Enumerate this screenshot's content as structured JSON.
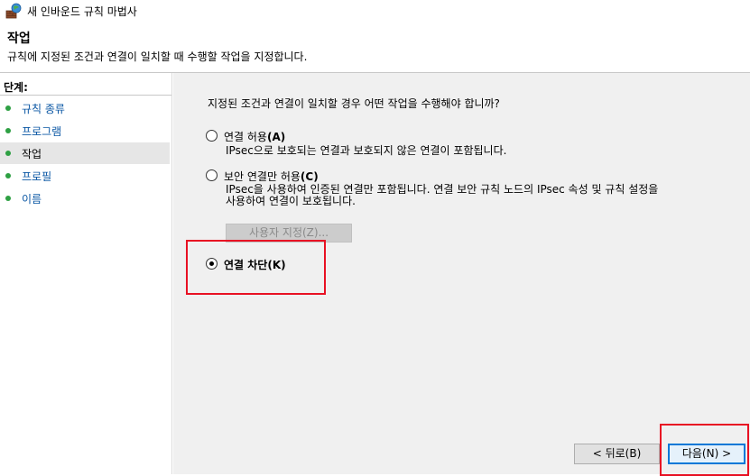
{
  "window": {
    "title": "새 인바운드 규칙 마법사",
    "icon": "firewall-wizard-icon"
  },
  "header": {
    "title": "작업",
    "description": "규칙에 지정된 조건과 연결이 일치할 때 수행할 작업을 지정합니다."
  },
  "steps": {
    "label": "단계:",
    "items": [
      {
        "label": "규칙 종류",
        "current": false
      },
      {
        "label": "프로그램",
        "current": false
      },
      {
        "label": "작업",
        "current": true
      },
      {
        "label": "프로필",
        "current": false
      },
      {
        "label": "이름",
        "current": false
      }
    ]
  },
  "content": {
    "question": "지정된 조건과 연결이 일치할 경우 어떤 작업을 수행해야 합니까?",
    "options": [
      {
        "label": "연결 허용",
        "mnemonic": "(A)",
        "description_lines": [
          "IPsec으로 보호되는 연결과 보호되지 않은 연결이 포함됩니다."
        ],
        "checked": false
      },
      {
        "label": "보안 연결만 허용",
        "mnemonic": "(C)",
        "description_lines": [
          "IPsec을 사용하여 인증된 연결만 포함됩니다. 연결 보안 규칙 노드의 IPsec 속성 및 규칙 설정을",
          "사용하여 연결이 보호됩니다."
        ],
        "checked": false
      },
      {
        "label": "연결 차단",
        "mnemonic": "(K)",
        "description_lines": [],
        "checked": true
      }
    ],
    "customize_button": "사용자 지정(Z)..."
  },
  "footer": {
    "back_button": "< 뒤로(B)",
    "next_button": "다음(N) >"
  },
  "colors": {
    "highlight": "#e81123",
    "step_dot": "#2ea043",
    "step_link": "#0b57a4",
    "panel_bg": "#f0f0f0",
    "primary_border": "#0078d7"
  }
}
